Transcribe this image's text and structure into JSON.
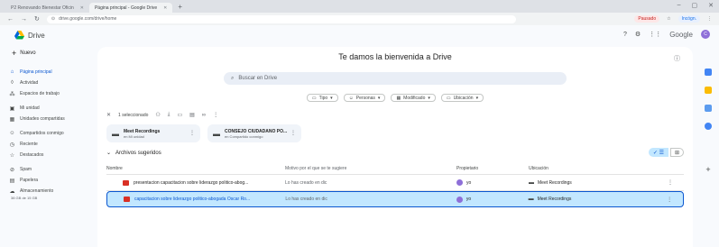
{
  "browser": {
    "tabs": [
      {
        "title": "P2 Renovando Bienestar Oficin",
        "active": false
      },
      {
        "title": "Página principal - Google Drive",
        "active": true
      }
    ],
    "new_tab": "+",
    "url": "drive.google.com/drive/home",
    "profile_pill": "Pausado",
    "account_pill": "Incógn."
  },
  "drive": {
    "app_title": "Drive",
    "google_word": "Google",
    "avatar_letter": "C",
    "new_button": "Nuevo",
    "nav": [
      {
        "label": "Página principal",
        "icon": "home-icon",
        "glyph": "⌂",
        "active": true
      },
      {
        "label": "Actividad",
        "icon": "activity-icon",
        "glyph": "◊",
        "active": false
      },
      {
        "label": "Espacios de trabajo",
        "icon": "workspaces-icon",
        "glyph": "⁂",
        "active": false
      },
      {
        "label": "Mi unidad",
        "icon": "my-drive-icon",
        "glyph": "▣",
        "active": false
      },
      {
        "label": "Unidades compartidas",
        "icon": "shared-drives-icon",
        "glyph": "▦",
        "active": false
      },
      {
        "label": "Compartidos conmigo",
        "icon": "shared-with-me-icon",
        "glyph": "☺",
        "active": false
      },
      {
        "label": "Reciente",
        "icon": "recent-icon",
        "glyph": "◷",
        "active": false
      },
      {
        "label": "Destacados",
        "icon": "starred-icon",
        "glyph": "☆",
        "active": false
      },
      {
        "label": "Spam",
        "icon": "spam-icon",
        "glyph": "⊘",
        "active": false
      },
      {
        "label": "Papelera",
        "icon": "trash-icon",
        "glyph": "▤",
        "active": false
      },
      {
        "label": "Almacenamiento",
        "icon": "storage-icon",
        "glyph": "☁",
        "active": false
      }
    ],
    "storage_note": "38 GB de 15 GB",
    "welcome": "Te damos la bienvenida a Drive",
    "search_placeholder": "Buscar en Drive",
    "filters": [
      "Tipo",
      "Personas",
      "Modificado",
      "Ubicación"
    ],
    "selection": {
      "label": "1 seleccionado"
    },
    "folders": [
      {
        "name": "Meet Recordings",
        "sub": "en Mi unidad"
      },
      {
        "name": "CONSEJO CIUDADANO PO...",
        "sub": "en Compartido conmigo"
      }
    ],
    "suggested_title": "Archivos sugeridos",
    "columns": {
      "name": "Nombre",
      "reason": "Motivo por el que se te sugiere",
      "owner": "Propietario",
      "location": "Ubicación"
    },
    "rows": [
      {
        "name": "presentacion capacitacion sobre liderazgo politico-abog...",
        "reason": "Lo has creado en dic",
        "owner": "yo",
        "location": "Meet Recordings",
        "selected": false
      },
      {
        "name": "capacitacion sobre liderazgo politico-abogada Oscar Ro...",
        "reason": "Lo has creado en dic",
        "owner": "yo",
        "location": "Meet Recordings",
        "selected": true
      }
    ],
    "colors": {
      "accent": "#0b57d0",
      "selected_row": "#c2e7ff",
      "pdf": "#d93025"
    }
  }
}
